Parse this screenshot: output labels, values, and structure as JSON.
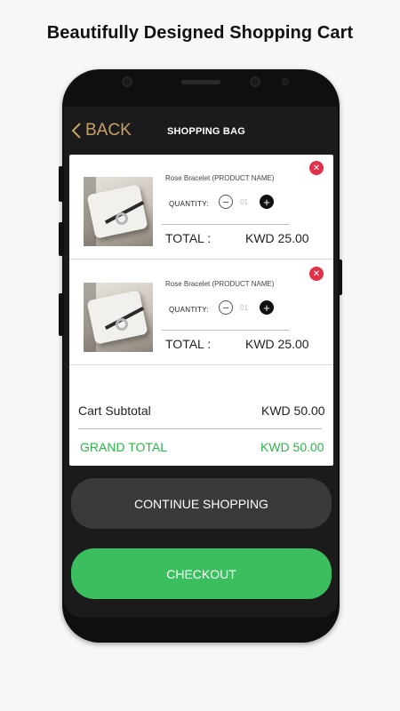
{
  "headline": "Beautifully Designed Shopping Cart",
  "nav": {
    "back_label": "BACK",
    "title": "SHOPPING BAG"
  },
  "items": [
    {
      "name": "Rose Bracelet (PRODUCT NAME)",
      "quantity_label": "QUANTITY:",
      "quantity": "01",
      "total_label": "TOTAL :",
      "total_value": "KWD 25.00"
    },
    {
      "name": "Rose Bracelet (PRODUCT NAME)",
      "quantity_label": "QUANTITY:",
      "quantity": "01",
      "total_label": "TOTAL :",
      "total_value": "KWD 25.00"
    }
  ],
  "summary": {
    "subtotal_label": "Cart Subtotal",
    "subtotal_value": "KWD 50.00",
    "grand_total_label": "GRAND TOTAL",
    "grand_total_value": "KWD 50.00"
  },
  "buttons": {
    "continue": "CONTINUE SHOPPING",
    "checkout": "CHECKOUT"
  },
  "icons": {
    "back": "chevron-left-icon",
    "remove": "close-icon",
    "minus": "minus-icon",
    "plus": "plus-icon"
  },
  "colors": {
    "accent": "#c8a165",
    "success": "#3bbf5e",
    "danger": "#e0304a",
    "text_green": "#2db34a"
  }
}
